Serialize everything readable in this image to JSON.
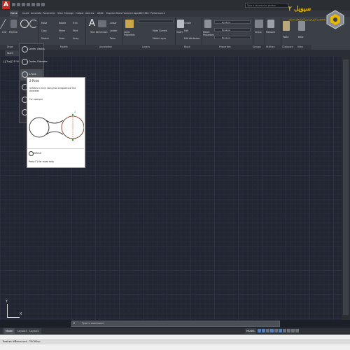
{
  "title_bar": {
    "app_logo_letter": "A",
    "search_placeholder": "Type a keyword or phrase"
  },
  "ribbon_tabs": [
    "Home",
    "Insert",
    "Annotate",
    "Parametric",
    "View",
    "Manage",
    "Output",
    "Add-ins",
    "A360",
    "Express Tools",
    "Featured Apps",
    "BIM 360",
    "Performance"
  ],
  "ribbon": {
    "line_label": "Line",
    "polyline_label": "Polyline",
    "modify": {
      "move": "Move",
      "rotate": "Rotate",
      "trim": "Trim",
      "copy": "Copy",
      "mirror": "Mirror",
      "fillet": "Fillet",
      "stretch": "Stretch",
      "scale": "Scale",
      "array": "Array"
    },
    "annotation": {
      "text": "Text",
      "dimension": "Dimension",
      "linear": "Linear",
      "leader": "Leader",
      "table": "Table"
    },
    "layers": {
      "layer_properties": "Layer Properties",
      "make_current": "Make Current",
      "match_layer": "Match Layer"
    },
    "block": {
      "insert": "Insert",
      "create": "Create",
      "edit": "Edit",
      "edit_attributes": "Edit Attributes"
    },
    "properties": {
      "match_properties": "Match Properties",
      "bylayer1": "ByLayer",
      "bylayer2": "ByLayer",
      "bylayer3": "ByLayer"
    },
    "groups_label": "Group",
    "utilities": {
      "measure": "Measure"
    },
    "clipboard": {
      "paste": "Paste"
    },
    "view": {
      "base": "Base"
    },
    "panel_titles": [
      "Draw",
      "Modify",
      "Annotation",
      "Layers",
      "Block",
      "Properties",
      "Groups",
      "Utilities",
      "Clipboard",
      "View"
    ]
  },
  "doc_tabs": {
    "start": "Start"
  },
  "viewport_label": "[-][Top][2D Wireframe]",
  "circle_menu": {
    "items": [
      "Center, Radius",
      "Center, Diameter",
      "2-Point",
      "3-Point",
      "Tan, Tan, Radius",
      "Tan, Tan, Tan"
    ]
  },
  "tooltip": {
    "title": "2-Point",
    "description": "Creates a circle using two endpoints of the diameter",
    "for_example": "For example",
    "point1": "1",
    "point2": "2",
    "command": "CIRCLE",
    "help": "Press F1 for more help"
  },
  "command_line": {
    "placeholder": "Type a command"
  },
  "ucs": {
    "x": "X",
    "y": "Y"
  },
  "layout_tabs": [
    "Model",
    "Layout1",
    "Layout2"
  ],
  "status": {
    "model": "MODEL"
  },
  "taskbar": [
    "Realtek HD",
    "Zoom and ...",
    "TECHSup"
  ],
  "brand": {
    "title": "سیویل ۲",
    "subtitle": "مرجع تخصصی آموزش نرم افزارهای عمران"
  },
  "colors": {
    "accent": "#c8281e",
    "brand": "#e6b800",
    "background": "#212632"
  }
}
